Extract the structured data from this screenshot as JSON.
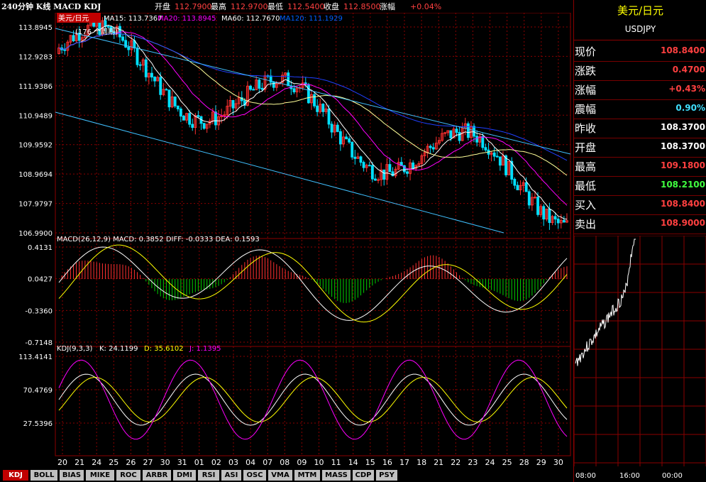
{
  "header": {
    "title": "240分钟 K线 MACD KDJ",
    "open_label": "开盘",
    "open": "112.7900",
    "high_label": "最高",
    "high": "112.9700",
    "low_label": "最低",
    "low": "112.5400",
    "close_label": "收盘",
    "close": "112.8500",
    "change_label": "涨幅",
    "change": "+0.04%"
  },
  "price_panel": {
    "symbol_tag": "美元/日元",
    "ma15": "MA15: 113.7367",
    "ma20": "MA20: 113.8945",
    "ma60": "MA60: 112.7670",
    "ma120": "MA120: 111.1929",
    "period_note": "(176 个周期)",
    "y_ticks": [
      "113.8945",
      "112.9283",
      "111.9386",
      "110.9489",
      "109.9592",
      "108.9694",
      "107.9797",
      "106.9900"
    ]
  },
  "macd_panel": {
    "label": "MACD(26,12,9) MACD: 0.3852  DIFF: -0.0333  DEA: 0.1593",
    "y_ticks": [
      "0.4131",
      "0.0427",
      "-0.3360",
      "-0.7148"
    ]
  },
  "kdj_panel": {
    "label_kdj": "KDJ(9,3,3)",
    "label_k": "K: 24.1199",
    "label_d": "D: 35.6102",
    "label_j": "J: 1.1395",
    "y_ticks": [
      "113.4141",
      "70.4769",
      "27.5396"
    ]
  },
  "x_ticks": [
    "20",
    "21",
    "24",
    "25",
    "26",
    "27",
    "30",
    "31",
    "01",
    "02",
    "03",
    "04",
    "07",
    "08",
    "09",
    "10",
    "11",
    "14",
    "15",
    "16",
    "17",
    "18",
    "21",
    "22",
    "23",
    "24",
    "25",
    "28",
    "29",
    "30"
  ],
  "tabs": [
    "KDJ",
    "BOLL",
    "BIAS",
    "MIKE",
    "ROC",
    "ARBR",
    "DMI",
    "RSI",
    "ASI",
    "OSC",
    "VMA",
    "MTM",
    "MASS",
    "CDP",
    "PSY"
  ],
  "quote": {
    "name": "美元/日元",
    "code": "USDJPY",
    "rows": [
      {
        "k": "现价",
        "v": "108.8400",
        "color": "#ff4040"
      },
      {
        "k": "涨跌",
        "v": "0.4700",
        "color": "#ff4040"
      },
      {
        "k": "涨幅",
        "v": "+0.43%",
        "color": "#ff4040"
      },
      {
        "k": "震幅",
        "v": "0.90%",
        "color": "#40e0ff"
      },
      {
        "k": "昨收",
        "v": "108.3700",
        "color": "#ffffff"
      },
      {
        "k": "开盘",
        "v": "108.3700",
        "color": "#ffffff"
      },
      {
        "k": "最高",
        "v": "109.1800",
        "color": "#ff4040"
      },
      {
        "k": "最低",
        "v": "108.2100",
        "color": "#40ff40"
      },
      {
        "k": "买入",
        "v": "108.8400",
        "color": "#ff4040"
      },
      {
        "k": "卖出",
        "v": "108.9000",
        "color": "#ff4040"
      }
    ],
    "time_ticks": [
      "08:00",
      "16:00",
      "00:00"
    ]
  },
  "colors": {
    "up": "#ff3030",
    "down": "#00e0ff",
    "grid": "#8b0000",
    "ma15": "#ffffff",
    "ma20": "#ffff00",
    "ma60": "#ff00ff",
    "ma120": "#0000ff"
  }
}
